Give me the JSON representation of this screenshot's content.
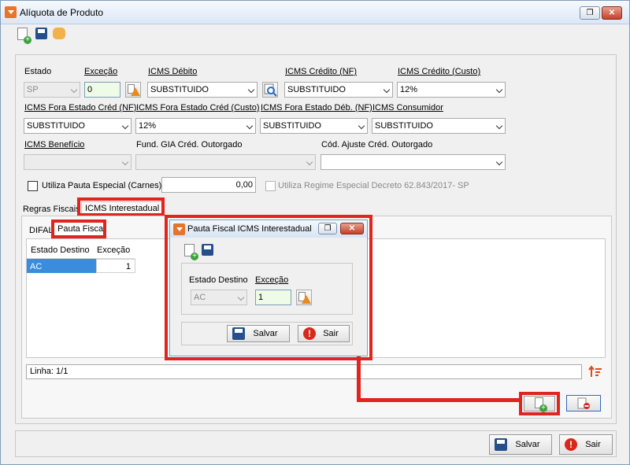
{
  "window": {
    "title": "Alíquota de Produto"
  },
  "toolbar": {
    "icons": [
      "new-doc-icon",
      "save-icon",
      "handshake-icon"
    ]
  },
  "form": {
    "estado": {
      "label": "Estado",
      "value": "SP"
    },
    "excecao": {
      "label": "Exceção",
      "value": "0"
    },
    "icms_debito": {
      "label": "ICMS Débito",
      "value": "SUBSTITUIDO"
    },
    "icms_credito_nf": {
      "label": "ICMS Crédito (NF)",
      "value": "SUBSTITUIDO"
    },
    "icms_credito_custo": {
      "label": "ICMS Crédito (Custo)",
      "value": "12%"
    },
    "icms_fora_estado_cred_nf": {
      "label": "ICMS Fora Estado Créd (NF)",
      "value": "SUBSTITUIDO"
    },
    "icms_fora_estado_cred_custo": {
      "label": "ICMS Fora Estado Créd (Custo)",
      "value": "12%"
    },
    "icms_fora_estado_deb_nf": {
      "label": "ICMS Fora Estado Déb. (NF)",
      "value": "SUBSTITUIDO"
    },
    "icms_consumidor": {
      "label": "ICMS Consumidor",
      "value": "SUBSTITUIDO"
    },
    "icms_beneficio": {
      "label": "ICMS Benefício",
      "value": ""
    },
    "fund_gia": {
      "label": "Fund. GIA Créd. Outorgado",
      "value": ""
    },
    "cod_ajuste": {
      "label": "Cód. Ajuste Créd. Outorgado",
      "value": ""
    },
    "pauta_especial": {
      "label": "Utiliza Pauta Especial (Carnes)",
      "value": "0,00"
    },
    "regime_especial": {
      "label": "Utiliza Regime Especial Decreto 62.843/2017- SP"
    }
  },
  "tabs": {
    "regras": "Regras Fiscais",
    "interestadual": "ICMS Interestadual"
  },
  "subtabs": {
    "difal": "DIFAL",
    "pauta": "Pauta Fiscal"
  },
  "grid": {
    "columns": [
      "Estado Destino",
      "Exceção"
    ],
    "rows": [
      {
        "estado": "AC",
        "excecao": "1"
      }
    ]
  },
  "status": {
    "linha": "Linha: 1/1"
  },
  "footer": {
    "save": "Salvar",
    "exit": "Sair"
  },
  "dialog": {
    "title": "Pauta Fiscal ICMS Interestadual",
    "estado_label": "Estado Destino",
    "estado_value": "AC",
    "excecao_label": "Exceção",
    "excecao_value": "1",
    "save": "Salvar",
    "exit": "Sair"
  }
}
